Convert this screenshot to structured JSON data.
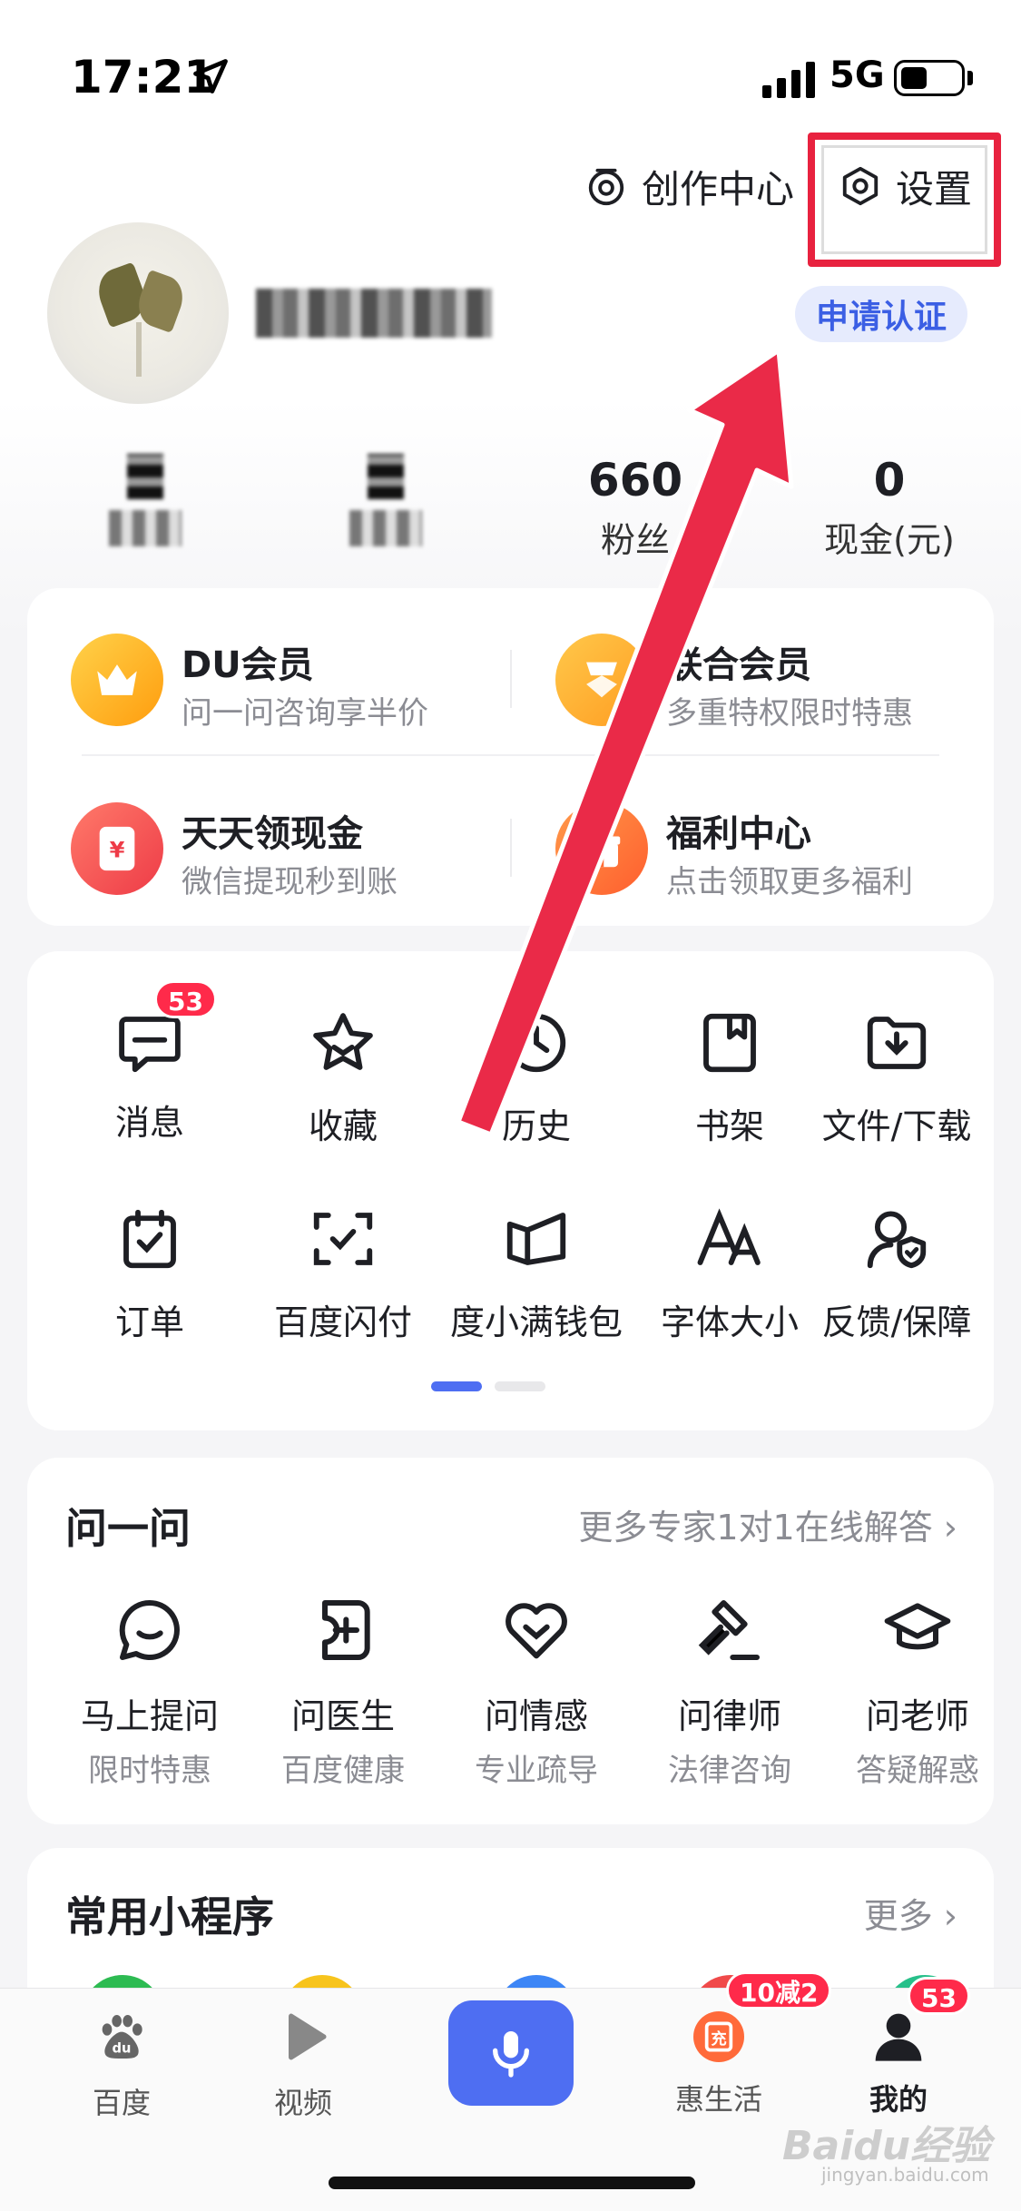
{
  "status_bar": {
    "time": "17:21",
    "network": "5G"
  },
  "header": {
    "creator_label": "创作中心",
    "settings_label": "设置"
  },
  "profile": {
    "apply_label": "申请认证"
  },
  "stats": [
    {
      "value": "660",
      "label": "粉丝"
    },
    {
      "value": "0",
      "label": "现金(元)"
    }
  ],
  "members": [
    {
      "title": "DU会员",
      "subtitle": "问一问咨询享半价",
      "color": "#ffb020",
      "icon": "crown-icon"
    },
    {
      "title": "联合会员",
      "subtitle": "多重特权限时特惠",
      "color": "#ffa726",
      "icon": "member-badge-icon"
    },
    {
      "title": "天天领现金",
      "subtitle": "微信提现秒到账",
      "color": "#f5504a",
      "icon": "cash-icon"
    },
    {
      "title": "福利中心",
      "subtitle": "点击领取更多福利",
      "color": "#ff7a2e",
      "icon": "gift-icon"
    }
  ],
  "tools": [
    {
      "label": "消息",
      "icon": "message-icon",
      "badge": "53"
    },
    {
      "label": "收藏",
      "icon": "star-icon"
    },
    {
      "label": "历史",
      "icon": "history-icon"
    },
    {
      "label": "书架",
      "icon": "bookshelf-icon"
    },
    {
      "label": "文件/下载",
      "icon": "download-folder-icon"
    },
    {
      "label": "订单",
      "icon": "order-icon"
    },
    {
      "label": "百度闪付",
      "icon": "scan-pay-icon"
    },
    {
      "label": "度小满钱包",
      "icon": "wallet-icon"
    },
    {
      "label": "字体大小",
      "icon": "font-size-icon"
    },
    {
      "label": "反馈/保障",
      "icon": "feedback-shield-icon"
    }
  ],
  "ask": {
    "title": "问一问",
    "more": "更多专家1对1在线解答",
    "items": [
      {
        "label": "马上提问",
        "sub": "限时特惠",
        "icon": "chat-bubble-icon"
      },
      {
        "label": "问医生",
        "sub": "百度健康",
        "icon": "medical-plus-icon"
      },
      {
        "label": "问情感",
        "sub": "专业疏导",
        "icon": "heart-icon"
      },
      {
        "label": "问律师",
        "sub": "法律咨询",
        "icon": "gavel-icon"
      },
      {
        "label": "问老师",
        "sub": "答疑解惑",
        "icon": "graduation-cap-icon"
      }
    ]
  },
  "mini_programs": {
    "title": "常用小程序",
    "more": "更多"
  },
  "tabbar": [
    {
      "label": "百度",
      "icon": "baidu-paw-icon"
    },
    {
      "label": "视频",
      "icon": "play-icon"
    },
    {
      "label": "",
      "icon": "microphone-icon"
    },
    {
      "label": "惠生活",
      "icon": "recharge-icon",
      "badge": "10减2"
    },
    {
      "label": "我的",
      "icon": "user-icon",
      "badge": "53"
    }
  ],
  "watermark": {
    "text": "Baidu经验",
    "sub": "jingyan.baidu.com"
  }
}
